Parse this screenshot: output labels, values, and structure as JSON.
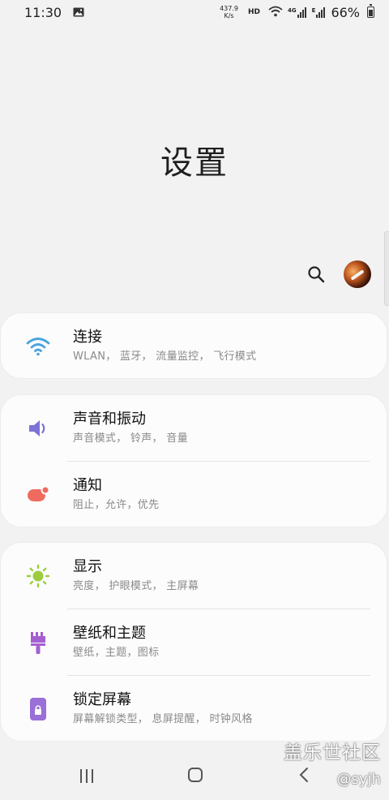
{
  "status_bar": {
    "time": "11:30",
    "speed_value": "437.9",
    "speed_unit": "K/s",
    "hd": "HD",
    "lte": "4G",
    "e": "E",
    "battery": "66%"
  },
  "page": {
    "title": "设置"
  },
  "groups": [
    {
      "items": [
        {
          "label": "连接",
          "desc": "WLAN， 蓝牙， 流量监控， 飞行模式",
          "icon": "wifi-icon"
        }
      ]
    },
    {
      "items": [
        {
          "label": "声音和振动",
          "desc": "声音模式， 铃声， 音量",
          "icon": "volume-icon"
        },
        {
          "label": "通知",
          "desc": "阻止，允许，优先",
          "icon": "notification-icon"
        }
      ]
    },
    {
      "items": [
        {
          "label": "显示",
          "desc": "亮度， 护眼模式， 主屏幕",
          "icon": "brightness-icon"
        },
        {
          "label": "壁纸和主题",
          "desc": "壁纸，主题，图标",
          "icon": "paint-brush-icon"
        },
        {
          "label": "锁定屏幕",
          "desc": "屏幕解锁类型， 息屏提醒， 时钟风格",
          "icon": "lock-icon"
        }
      ]
    }
  ],
  "watermark": {
    "main": "盖乐世社区",
    "user": "@syjh"
  },
  "colors": {
    "wifi": "#4aa3df",
    "volume": "#7b73d6",
    "notification": "#ef6b5f",
    "brightness": "#9ccc3d",
    "wallpaper": "#a55fd0",
    "lock": "#9a6fd8"
  }
}
